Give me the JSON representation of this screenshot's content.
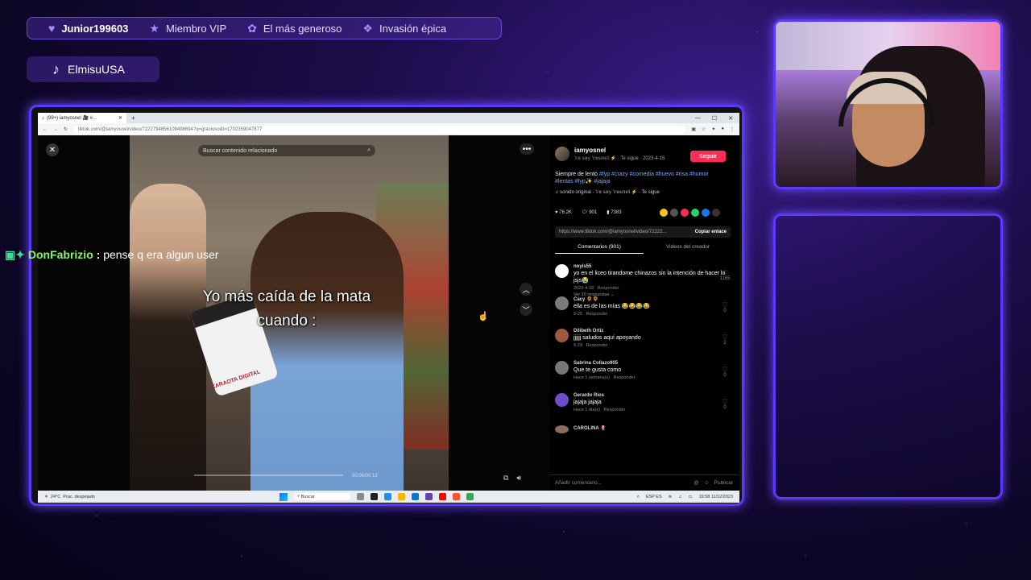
{
  "alerts": [
    {
      "icon": "heart-icon",
      "label": "Junior199603"
    },
    {
      "icon": "star-icon",
      "label": "Miembro VIP"
    },
    {
      "icon": "gift-icon",
      "label": "El más generoso"
    },
    {
      "icon": "paw-icon",
      "label": "Invasión épica"
    }
  ],
  "handle": {
    "icon": "tiktok-icon",
    "label": "ElmisuUSA"
  },
  "browser": {
    "tab_title": "(99+) iamyosnel 🎥 #...",
    "url": "tiktok.com/@iamyosnel/video/7222794856109498694?q=gracioso&t=1702359047877"
  },
  "video": {
    "search_placeholder": "Buscar contenido relacionado",
    "caption_line1": "Yo más caída de la mata",
    "caption_line2": "cuando :",
    "mic_label": "CARAOTA DIGITAL",
    "time": "00:06/00:13"
  },
  "post": {
    "author": "iamyosnel",
    "author_meta": "𝕐𝕠 𝕤𝕠𝕪 𝕐𝕠𝕤𝕟𝕖𝕝 ⚡ · Te sigue · 2023-4-15",
    "follow_label": "Seguir",
    "desc_text": "Siempre de lento",
    "desc_tags": "#fyp #crazy #comedia #huevo #risa #humor #lentas #fyp✨ #jajaja",
    "sound": "♫ sonido original - 𝕐𝕠 𝕤𝕠𝕪 𝕐𝕠𝕤𝕟𝕖𝕝 ⚡ · Te sigue",
    "likes": "76.2K",
    "comments_count": "901",
    "saves": "7383",
    "link": "https://www.tiktok.com/@iamyosnel/video/72222...",
    "copy_label": "Copiar enlace",
    "tabs": [
      "Comentarios (901)",
      "Videos del creador"
    ]
  },
  "comments": [
    {
      "user": "noyis55",
      "text": "yo en el liceo tirandome chinazos sin la intención de hacer lo jsjs😭",
      "date": "2023-4-18",
      "reply": "Responder",
      "likes": "1165",
      "replies": "Ver 15 respuestas ⌄",
      "color": "#ffffff"
    },
    {
      "user": "Cacy 🌻🌻",
      "text": "ella es de las mías 😂😂😂😂",
      "date": "9-25",
      "reply": "Responder",
      "likes": "0",
      "replies": "",
      "color": "#7a7a7a"
    },
    {
      "user": "Dilibeth Ortiz",
      "text": "jjjjjj saludos aquí apoyando",
      "date": "9-29",
      "reply": "Responder",
      "likes": "2",
      "replies": "",
      "color": "#9c5a3c"
    },
    {
      "user": "Sabrina Collazo905",
      "text": "Que te gusta como",
      "date": "Hace 1 semana(s)",
      "reply": "Responder",
      "likes": "0",
      "replies": "",
      "color": "#777777"
    },
    {
      "user": "Gerardo Ríos",
      "text": "jajaja jajaja",
      "date": "Hace 1 día(s)",
      "reply": "Responder",
      "likes": "0",
      "replies": "",
      "color": "#6f4cc9"
    },
    {
      "user": "CAROLINA 🌷",
      "text": "",
      "date": "",
      "reply": "",
      "likes": "",
      "replies": "",
      "color": "#8a6c60"
    }
  ],
  "comment_input": {
    "placeholder": "Añadir comentario...",
    "post_label": "Publicar"
  },
  "taskbar": {
    "weather": "24°C",
    "weather_desc": "Prac. despejado",
    "search": "Buscar",
    "lang": "ESP",
    "lang2": "ES",
    "time": "19:58",
    "date": "11/12/2023"
  },
  "chat": {
    "user": "DonFabrizio",
    "text": "pense q era algun user"
  }
}
